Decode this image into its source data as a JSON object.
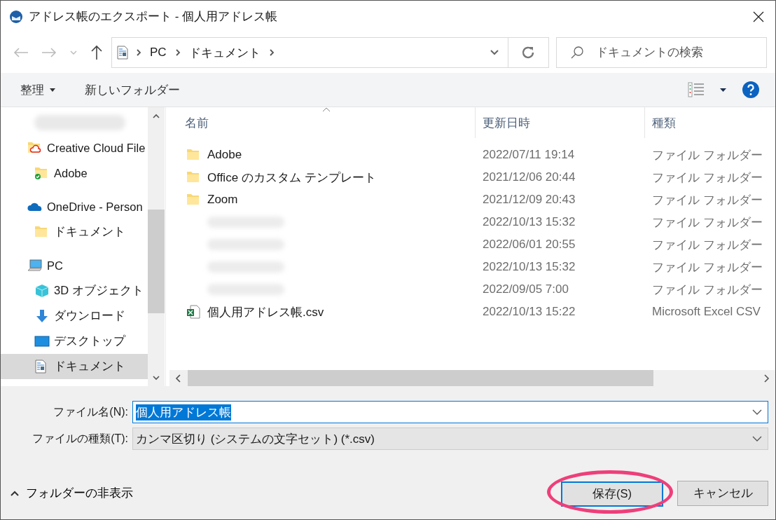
{
  "window": {
    "title": "アドレス帳のエクスポート - 個人用アドレス帳"
  },
  "address": {
    "crumbs": [
      "PC",
      "ドキュメント"
    ]
  },
  "search": {
    "placeholder": "ドキュメントの検索"
  },
  "toolbar": {
    "organize": "整理",
    "new_folder": "新しいフォルダー"
  },
  "sidebar": {
    "items": [
      {
        "kind": "blurred",
        "selected": false
      },
      {
        "kind": "creative_cloud",
        "label": "Creative Cloud File",
        "selected": false,
        "children": [
          {
            "kind": "synced_folder",
            "label": "Adobe",
            "selected": false
          }
        ]
      },
      {
        "kind": "onedrive",
        "label": "OneDrive - Person",
        "selected": false,
        "children": [
          {
            "kind": "folder",
            "label": "ドキュメント",
            "selected": false
          }
        ]
      },
      {
        "kind": "pc",
        "label": "PC",
        "selected": false,
        "children": [
          {
            "kind": "objects3d",
            "label": "3D オブジェクト",
            "selected": false
          },
          {
            "kind": "download",
            "label": "ダウンロード",
            "selected": false
          },
          {
            "kind": "desktop",
            "label": "デスクトップ",
            "selected": false
          },
          {
            "kind": "documents",
            "label": "ドキュメント",
            "selected": true
          }
        ]
      }
    ]
  },
  "table": {
    "columns": [
      {
        "label": "名前",
        "sorted": true
      },
      {
        "label": "更新日時",
        "sorted": false
      },
      {
        "label": "種類",
        "sorted": false
      }
    ],
    "rows": [
      {
        "kind": "folder",
        "name": "Adobe",
        "modified": "2022/07/11 19:14",
        "type": "ファイル フォルダー"
      },
      {
        "kind": "folder",
        "name": "Office のカスタム テンプレート",
        "modified": "2021/12/06 20:44",
        "type": "ファイル フォルダー"
      },
      {
        "kind": "folder",
        "name": "Zoom",
        "modified": "2021/12/09 20:43",
        "type": "ファイル フォルダー"
      },
      {
        "kind": "blurred",
        "modified": "2022/10/13 15:32",
        "type": "ファイル フォルダー"
      },
      {
        "kind": "blurred",
        "modified": "2022/06/01 20:55",
        "type": "ファイル フォルダー"
      },
      {
        "kind": "blurred",
        "modified": "2022/10/13 15:32",
        "type": "ファイル フォルダー"
      },
      {
        "kind": "blurred",
        "modified": "2022/09/05 7:00",
        "type": "ファイル フォルダー"
      },
      {
        "kind": "csv",
        "name": "個人用アドレス帳.csv",
        "modified": "2022/10/13 15:22",
        "type": "Microsoft Excel CSV"
      }
    ]
  },
  "file_name": {
    "label": "ファイル名(N):",
    "value": "個人用アドレス帳"
  },
  "file_type": {
    "label": "ファイルの種類(T):",
    "value": "カンマ区切り (システムの文字セット) (*.csv)"
  },
  "hide_folders": "フォルダーの非表示",
  "buttons": [
    {
      "label": "保存(S)",
      "highlighted": true
    },
    {
      "label": "キャンセル",
      "highlighted": false
    }
  ]
}
